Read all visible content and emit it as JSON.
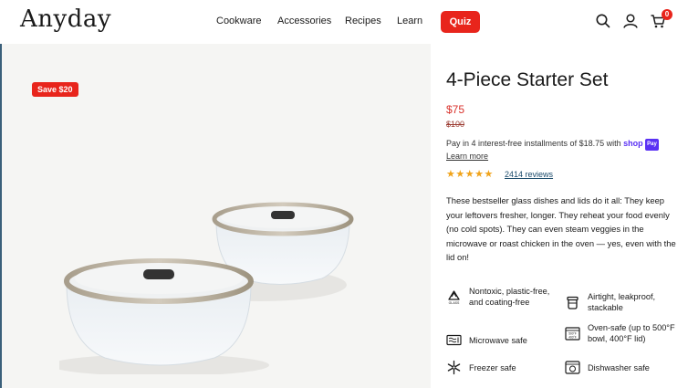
{
  "header": {
    "logo": "Anyday",
    "nav": [
      "Cookware",
      "Accessories",
      "Recipes",
      "Learn"
    ],
    "quiz_label": "Quiz",
    "cart_count": "0",
    "icons": [
      "search-icon",
      "account-icon",
      "cart-icon"
    ]
  },
  "gallery": {
    "save_badge": "Save $20"
  },
  "product": {
    "title": "4-Piece Starter Set",
    "price": "$75",
    "compare_price": "$100",
    "installment_text": "Pay in 4 interest-free installments of $18.75 with",
    "shop_brand": "shop",
    "shop_pay_tag": "Pay",
    "learn_more": "Learn more",
    "stars": "★★★★★",
    "rating_count": 5,
    "reviews_label": "2414 reviews",
    "description": "These bestseller glass dishes and lids do it all: They keep your leftovers fresher, longer. They reheat your food evenly (no cold spots). They can even steam veggies in the microwave or roast chicken in the oven — yes, even with the lid on!"
  },
  "features": [
    {
      "icon": "recycle-icon",
      "label": "Nontoxic, plastic-free, and coating-free"
    },
    {
      "icon": "container-icon",
      "label": "Airtight, leakproof, stackable"
    },
    {
      "icon": "microwave-icon",
      "label": "Microwave safe"
    },
    {
      "icon": "oven-icon",
      "label": "Oven-safe (up to 500°F bowl, 400°F lid)"
    },
    {
      "icon": "snowflake-icon",
      "label": "Freezer safe"
    },
    {
      "icon": "dishwasher-icon",
      "label": "Dishwasher safe"
    }
  ],
  "colors": {
    "accent": "#e8251c",
    "price": "#d9312b",
    "stars": "#f0a31a",
    "shop_pay": "#5a31f4"
  }
}
